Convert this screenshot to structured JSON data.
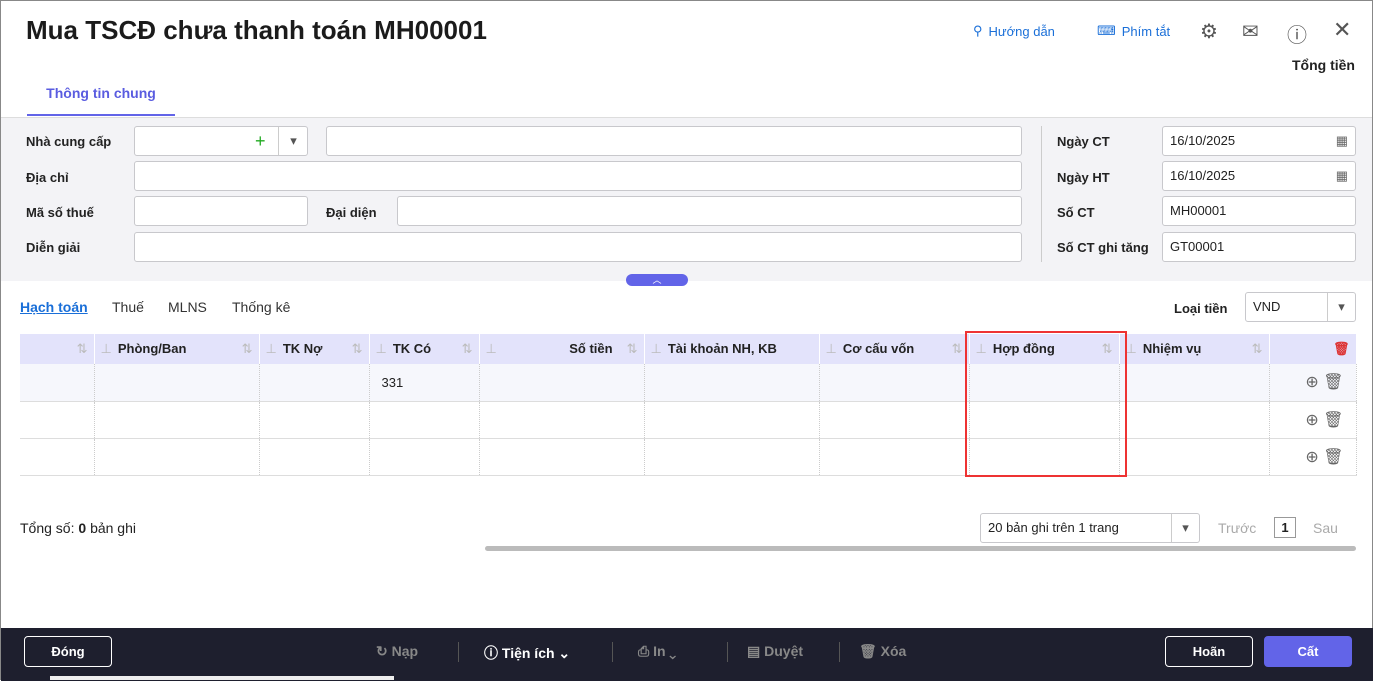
{
  "header": {
    "title": "Mua TSCĐ chưa thanh toán MH00001",
    "guide": "Hướng dẫn",
    "shortcuts": "Phím tắt",
    "total_label": "Tổng tiền"
  },
  "tabs": [
    "Thông tin chung"
  ],
  "form": {
    "supplier_label": "Nhà cung cấp",
    "address_label": "Địa chỉ",
    "tax_label": "Mã số thuế",
    "rep_label": "Đại diện",
    "desc_label": "Diễn giải",
    "doc_date_label": "Ngày CT",
    "doc_date": "16/10/2025",
    "post_date_label": "Ngày HT",
    "post_date": "16/10/2025",
    "doc_no_label": "Số CT",
    "doc_no": "MH00001",
    "inc_no_label": "Số CT ghi tăng",
    "inc_no": "GT00001"
  },
  "subtabs": [
    "Hạch toán",
    "Thuế",
    "MLNS",
    "Thống kê"
  ],
  "currency": {
    "label": "Loại tiền",
    "value": "VND"
  },
  "table": {
    "columns": [
      "",
      "Phòng/Ban",
      "TK Nợ",
      "TK Có",
      "Số tiền",
      "Tài khoản NH, KB",
      "Cơ cấu vốn",
      "Hợp đồng",
      "Nhiệm vụ"
    ],
    "rows": [
      [
        "",
        "",
        "",
        "331",
        "",
        "",
        "",
        "",
        ""
      ],
      [
        "",
        "",
        "",
        "",
        "",
        "",
        "",
        "",
        ""
      ],
      [
        "",
        "",
        "",
        "",
        "",
        "",
        "",
        "",
        ""
      ]
    ]
  },
  "pager": {
    "total_prefix": "Tổng số:",
    "total_count": "0",
    "total_suffix": "bản ghi",
    "page_size": "20 bản ghi trên 1 trang",
    "prev": "Trước",
    "page": "1",
    "next": "Sau"
  },
  "footer": {
    "close": "Đóng",
    "reload": "Nạp",
    "utilities": "Tiện ích",
    "print": "In",
    "approve": "Duyệt",
    "delete": "Xóa",
    "cancel": "Hoãn",
    "save": "Cất"
  }
}
